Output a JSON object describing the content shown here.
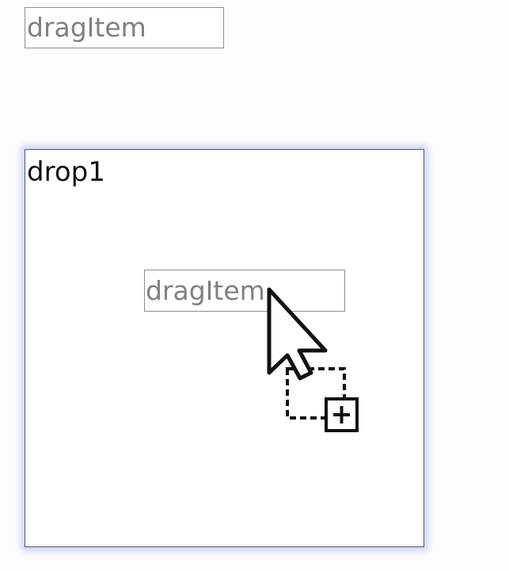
{
  "drag_source": {
    "label": "dragItem"
  },
  "drop_zone": {
    "label": "drop1",
    "accent_glow": "#96a5f0",
    "border_color": "#555a6a"
  },
  "drag_ghost": {
    "label": "dragItem"
  },
  "cursor": {
    "icon": "arrow-cursor-copy-icon",
    "badge_icon": "plus-icon"
  },
  "colors": {
    "text_muted": "#808080",
    "text_dark": "#111111",
    "box_border": "#8f8f8f"
  }
}
